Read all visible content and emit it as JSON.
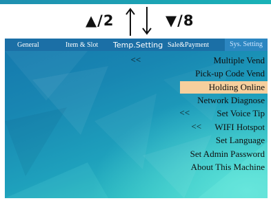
{
  "hints": {
    "up": "▲/2",
    "down": "▼/8"
  },
  "tabs": [
    {
      "label": "General"
    },
    {
      "label": "Item & Slot"
    },
    {
      "label": "Temp.Setting"
    },
    {
      "label": "Sale&Payment"
    },
    {
      "label": "Sys. Setting"
    }
  ],
  "active_tab_index": 4,
  "menu": {
    "items": [
      {
        "label": "Multiple Vend",
        "prefix": "<<"
      },
      {
        "label": "Pick-up Code Vend",
        "prefix": ""
      },
      {
        "label": "Holding Online",
        "prefix": ""
      },
      {
        "label": "Network Diagnose",
        "prefix": ""
      },
      {
        "label": "Set Voice Tip",
        "prefix": "<<"
      },
      {
        "label": "WIFI Hotspot",
        "prefix": "<<"
      },
      {
        "label": "Set Language",
        "prefix": ""
      },
      {
        "label": "Set Admin Password",
        "prefix": ""
      },
      {
        "label": "About This Machine",
        "prefix": ""
      }
    ],
    "selected_index": 2
  },
  "colors": {
    "tab_bar": "#1b6fa6",
    "active_tab": "#2c86c1",
    "selected_row": "#f6cf9d",
    "screen_top": "#1578ad",
    "screen_bottom": "#48d1c9"
  }
}
